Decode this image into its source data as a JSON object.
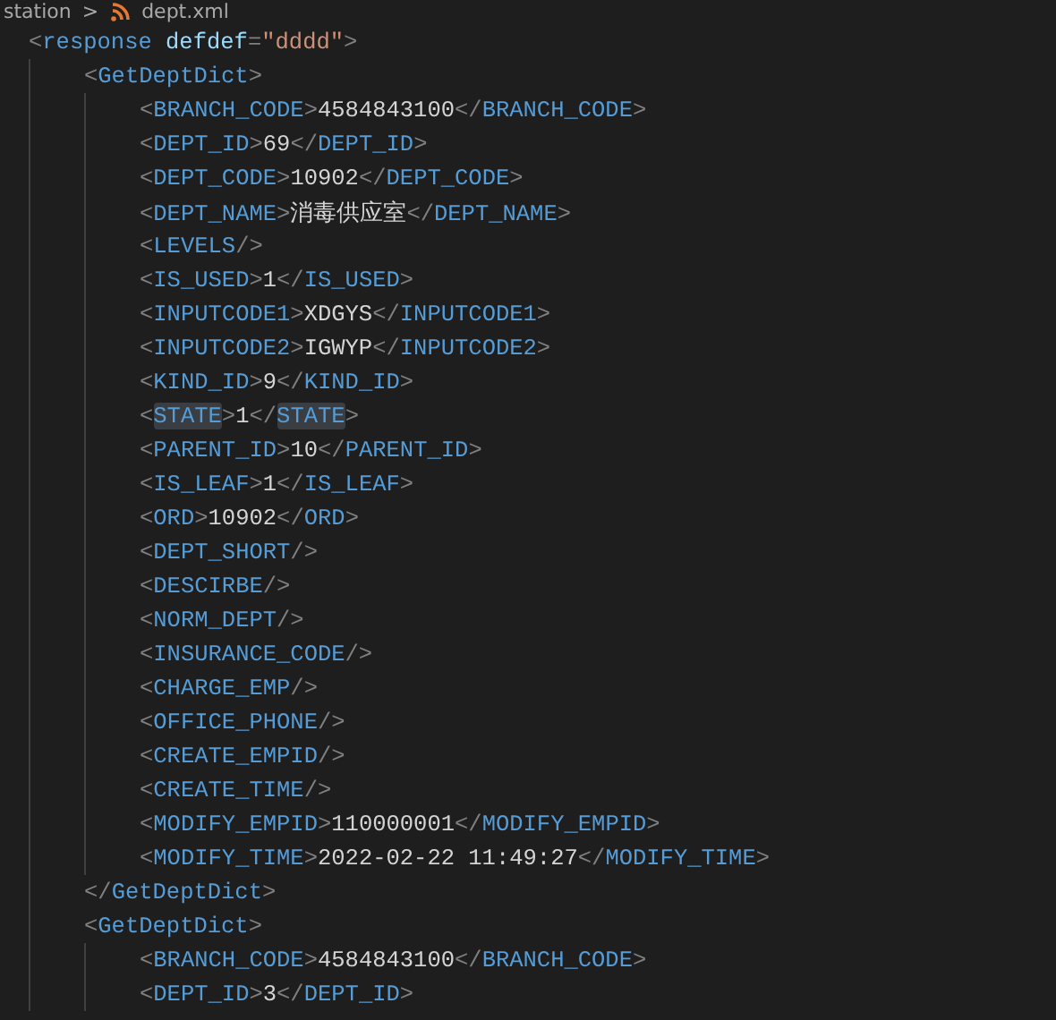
{
  "breadcrumb": {
    "folder": "station",
    "separator": ">",
    "file": "dept.xml"
  },
  "document": {
    "kind": "parent",
    "line": "<response defdef=\"dddd\">",
    "children": [
      {
        "kind": "parent",
        "line": "<GetDeptDict>",
        "close": "</GetDeptDict>",
        "children": [
          {
            "kind": "leaf",
            "line": "<BRANCH_CODE>4584843100</BRANCH_CODE>",
            "highlighted": false
          },
          {
            "kind": "leaf",
            "line": "<DEPT_ID>69</DEPT_ID>",
            "highlighted": false
          },
          {
            "kind": "leaf",
            "line": "<DEPT_CODE>10902</DEPT_CODE>",
            "highlighted": false
          },
          {
            "kind": "leaf",
            "line": "<DEPT_NAME>消毒供应室</DEPT_NAME>",
            "highlighted": false
          },
          {
            "kind": "leaf",
            "line": "<LEVELS/>",
            "highlighted": false
          },
          {
            "kind": "leaf",
            "line": "<IS_USED>1</IS_USED>",
            "highlighted": false
          },
          {
            "kind": "leaf",
            "line": "<INPUTCODE1>XDGYS</INPUTCODE1>",
            "highlighted": false
          },
          {
            "kind": "leaf",
            "line": "<INPUTCODE2>IGWYP</INPUTCODE2>",
            "highlighted": false
          },
          {
            "kind": "leaf",
            "line": "<KIND_ID>9</KIND_ID>",
            "highlighted": false
          },
          {
            "kind": "leaf",
            "line": "<STATE>1</STATE>",
            "highlighted": true
          },
          {
            "kind": "leaf",
            "line": "<PARENT_ID>10</PARENT_ID>",
            "highlighted": false
          },
          {
            "kind": "leaf",
            "line": "<IS_LEAF>1</IS_LEAF>",
            "highlighted": false
          },
          {
            "kind": "leaf",
            "line": "<ORD>10902</ORD>",
            "highlighted": false
          },
          {
            "kind": "leaf",
            "line": "<DEPT_SHORT/>",
            "highlighted": false
          },
          {
            "kind": "leaf",
            "line": "<DESCIRBE/>",
            "highlighted": false
          },
          {
            "kind": "leaf",
            "line": "<NORM_DEPT/>",
            "highlighted": false
          },
          {
            "kind": "leaf",
            "line": "<INSURANCE_CODE/>",
            "highlighted": false
          },
          {
            "kind": "leaf",
            "line": "<CHARGE_EMP/>",
            "highlighted": false
          },
          {
            "kind": "leaf",
            "line": "<OFFICE_PHONE/>",
            "highlighted": false
          },
          {
            "kind": "leaf",
            "line": "<CREATE_EMPID/>",
            "highlighted": false
          },
          {
            "kind": "leaf",
            "line": "<CREATE_TIME/>",
            "highlighted": false
          },
          {
            "kind": "leaf",
            "line": "<MODIFY_EMPID>110000001</MODIFY_EMPID>",
            "highlighted": false
          },
          {
            "kind": "leaf",
            "line": "<MODIFY_TIME>2022-02-22 11:49:27</MODIFY_TIME>",
            "highlighted": false
          }
        ]
      },
      {
        "kind": "parent",
        "line": "<GetDeptDict>",
        "children": [
          {
            "kind": "leaf",
            "line": "<BRANCH_CODE>4584843100</BRANCH_CODE>",
            "highlighted": false
          },
          {
            "kind": "leaf",
            "line": "<DEPT_ID>3</DEPT_ID>",
            "highlighted": false
          }
        ]
      }
    ]
  }
}
